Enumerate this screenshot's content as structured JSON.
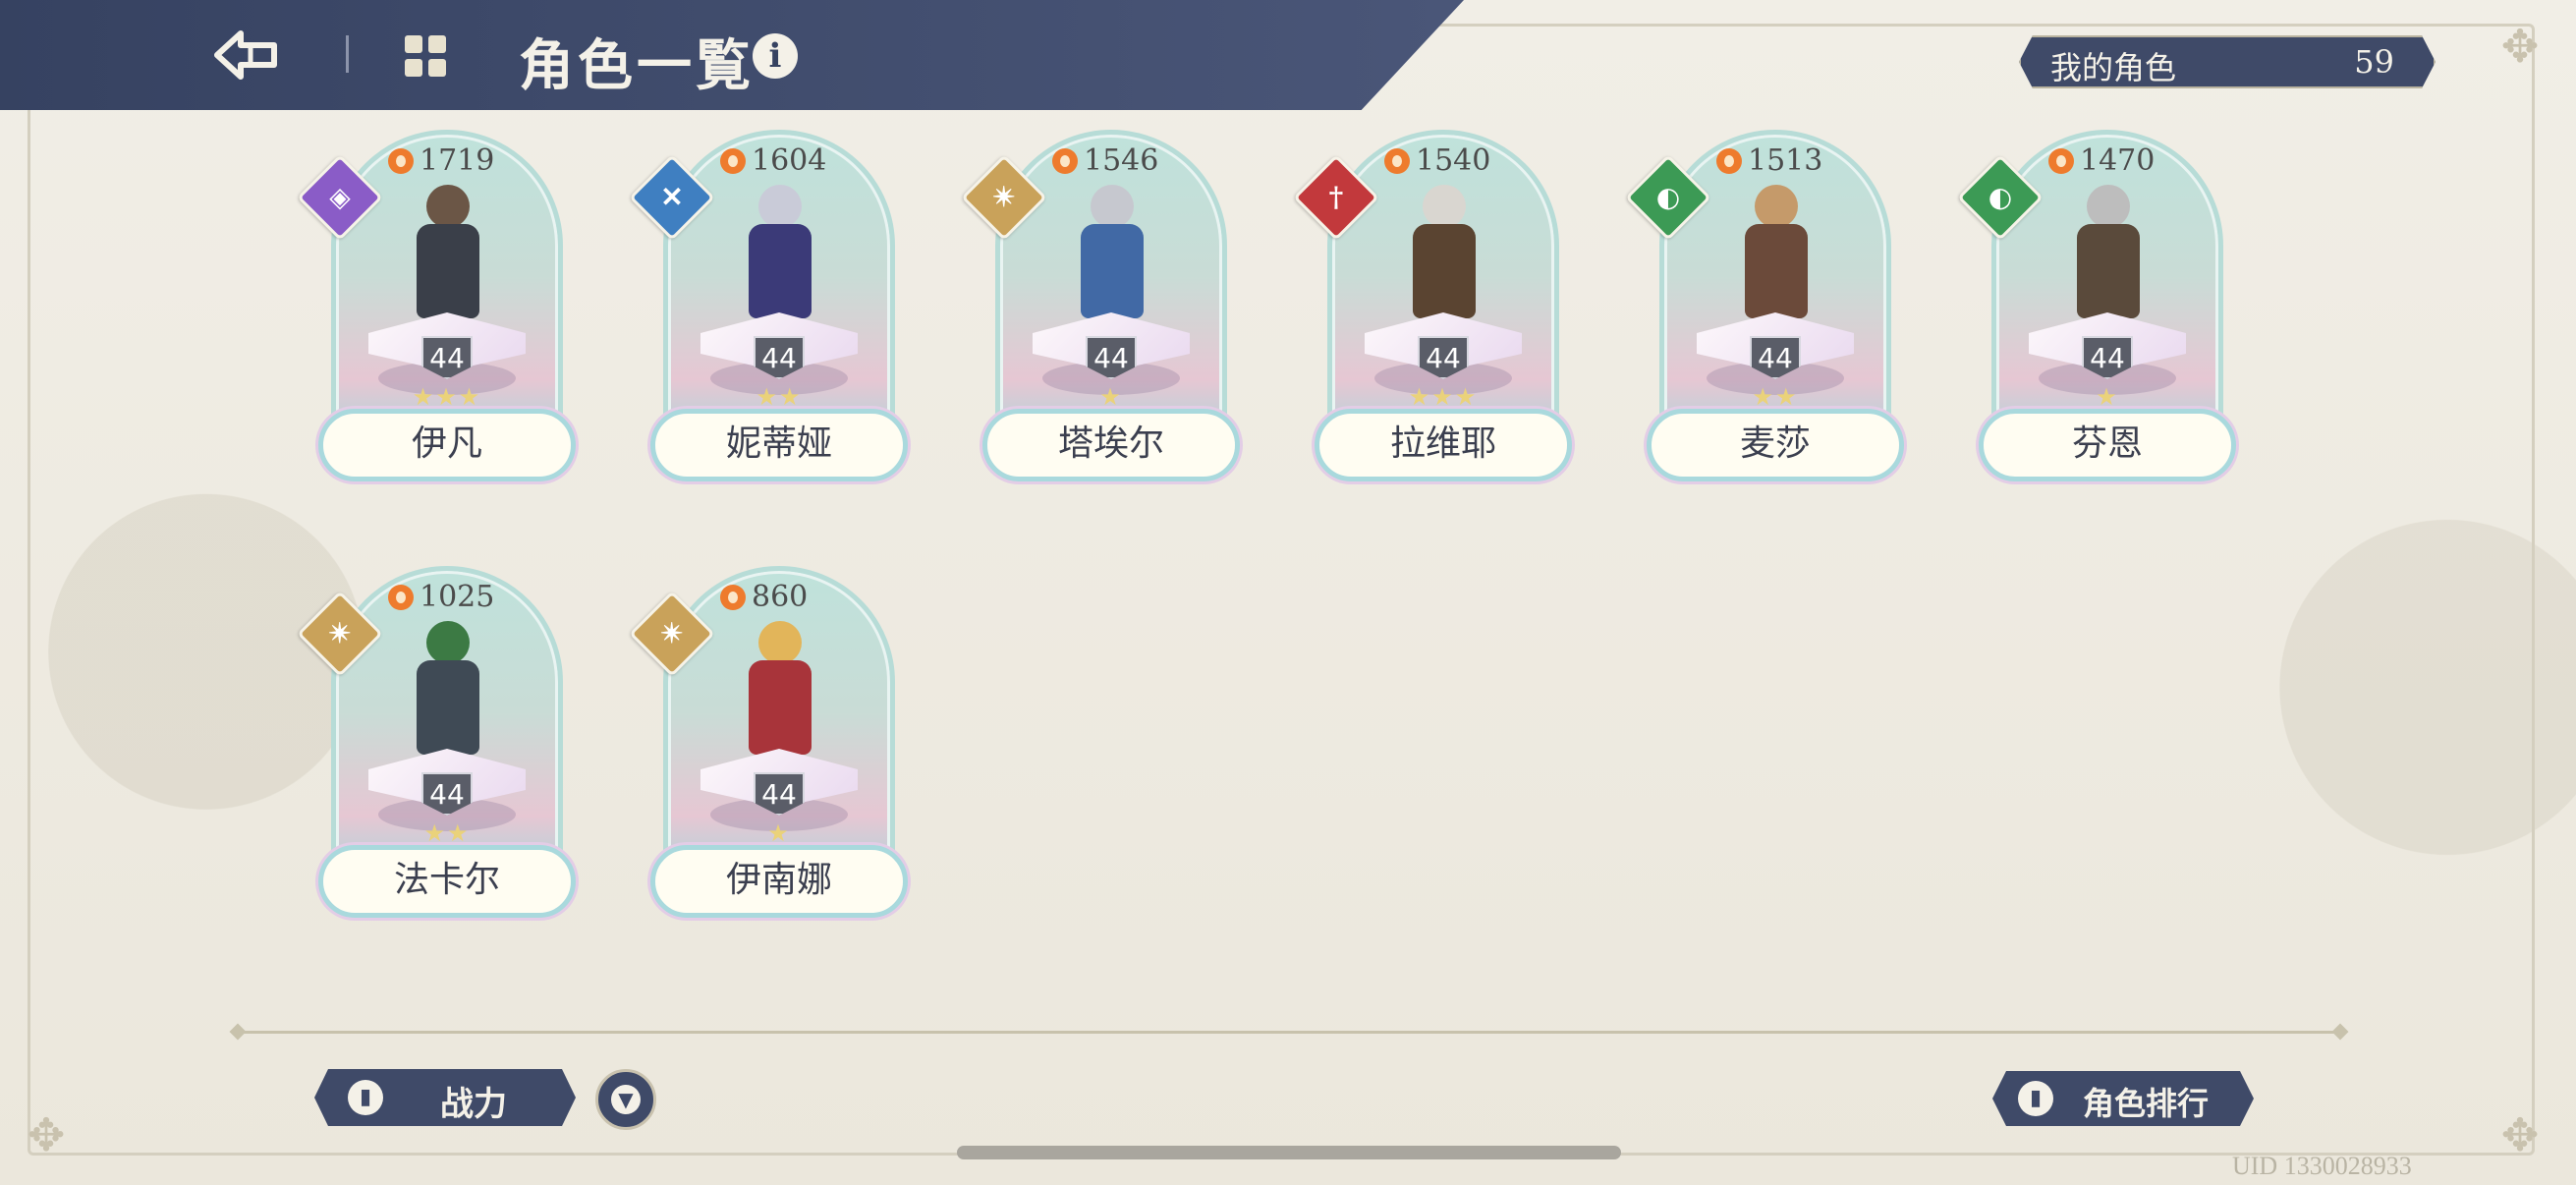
{
  "header": {
    "title": "角色一覧",
    "back_icon": "back-arrow-icon",
    "grid_icon": "grid-icon",
    "info_icon": "i"
  },
  "my_characters": {
    "label": "我的角色",
    "count": "59"
  },
  "characters": [
    {
      "name": "伊凡",
      "power": "1719",
      "level": "44",
      "stars": "★★★",
      "element": "purple",
      "element_color": "#8a5cc7",
      "hair": "#6b5646",
      "outfit": "#3a3f49"
    },
    {
      "name": "妮蒂娅",
      "power": "1604",
      "level": "44",
      "stars": "★★",
      "element": "blue",
      "element_color": "#3f7fc1",
      "hair": "#c9cbd8",
      "outfit": "#3b3a78"
    },
    {
      "name": "塔埃尔",
      "power": "1546",
      "level": "44",
      "stars": "★",
      "element": "light",
      "element_color": "#c9a25a",
      "hair": "#c6c8cf",
      "outfit": "#4169a5"
    },
    {
      "name": "拉维耶",
      "power": "1540",
      "level": "44",
      "stars": "★★★",
      "element": "fire",
      "element_color": "#c2393c",
      "hair": "#d9d6d0",
      "outfit": "#5a4431"
    },
    {
      "name": "麦莎",
      "power": "1513",
      "level": "44",
      "stars": "★★",
      "element": "wind",
      "element_color": "#3c9a55",
      "hair": "#c59a6a",
      "outfit": "#6b4a3a"
    },
    {
      "name": "芬恩",
      "power": "1470",
      "level": "44",
      "stars": "★",
      "element": "wind",
      "element_color": "#3c9a55",
      "hair": "#bdbdbd",
      "outfit": "#5a4a3b"
    },
    {
      "name": "法卡尔",
      "power": "1025",
      "level": "44",
      "stars": "★★",
      "element": "light",
      "element_color": "#c9a25a",
      "hair": "#3c7a44",
      "outfit": "#3f4a55"
    },
    {
      "name": "伊南娜",
      "power": "860",
      "level": "44",
      "stars": "★",
      "element": "light",
      "element_color": "#c9a25a",
      "hair": "#e2b55a",
      "outfit": "#a8343a"
    }
  ],
  "footer": {
    "sort_label": "战力",
    "rank_label": "角色排行",
    "uid": "UID 1330028933"
  }
}
